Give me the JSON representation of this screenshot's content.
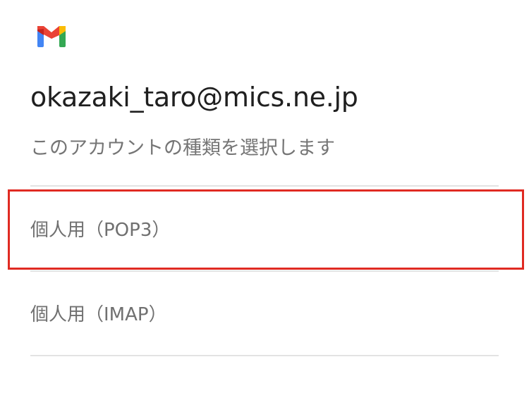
{
  "app": {
    "logo_icon": "gmail-logo-icon"
  },
  "account": {
    "email": "okazaki_taro@mics.ne.jp",
    "prompt": "このアカウントの種類を選択します"
  },
  "options": [
    {
      "label": "個人用（POP3）"
    },
    {
      "label": "個人用（IMAP）"
    }
  ],
  "annotation": {
    "highlight_color": "#e02a22"
  },
  "colors": {
    "divider": "#e3e3e3",
    "option_text": "#707070",
    "prompt_text": "#757575",
    "email_text": "#1f1f1f"
  }
}
